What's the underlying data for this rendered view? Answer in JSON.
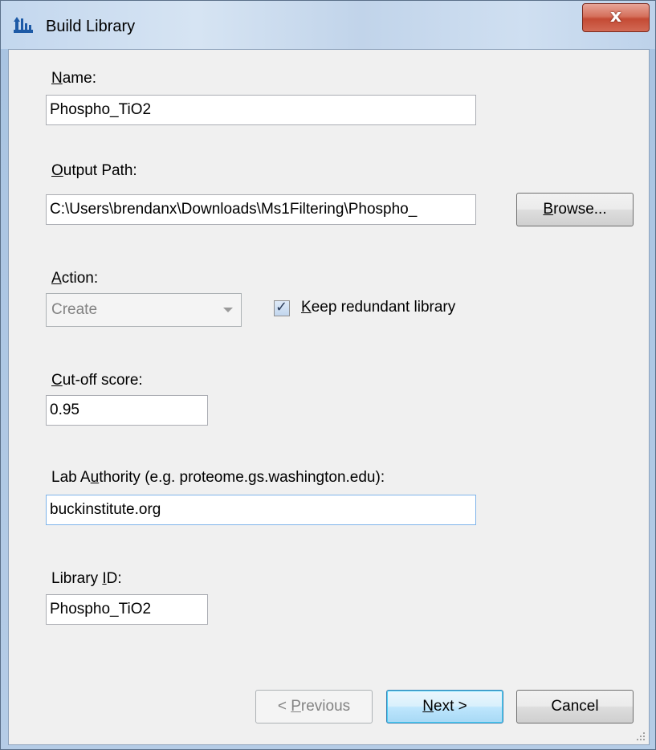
{
  "window": {
    "title": "Build Library",
    "close_glyph": "x"
  },
  "fields": {
    "name": {
      "label_u": "N",
      "label_rest": "ame:",
      "value": "Phospho_TiO2"
    },
    "output_path": {
      "label_u": "O",
      "label_rest": "utput Path:",
      "value": "C:\\Users\\brendanx\\Downloads\\Ms1Filtering\\Phospho_"
    },
    "action": {
      "label_u": "A",
      "label_rest": "ction:",
      "value": "Create"
    },
    "keep_redundant": {
      "label_u": "K",
      "label_rest": "eep redundant library",
      "checked": true
    },
    "cutoff": {
      "label_u": "C",
      "label_rest": "ut-off score:",
      "value": "0.95"
    },
    "lab_authority": {
      "label_pre": "Lab A",
      "label_u": "u",
      "label_rest": "thority (e.g. proteome.gs.washington.edu):",
      "value": "buckinstitute.org"
    },
    "library_id": {
      "label_pre": "Library ",
      "label_u": "I",
      "label_rest": "D:",
      "value": "Phospho_TiO2"
    }
  },
  "buttons": {
    "browse": {
      "u": "B",
      "rest": "rowse..."
    },
    "previous": {
      "pre": "< ",
      "u": "P",
      "rest": "revious"
    },
    "next": {
      "u": "N",
      "rest": "ext >"
    },
    "cancel": {
      "label": "Cancel"
    }
  },
  "icons": {
    "title": "library-icon",
    "check": "checkmark-icon"
  },
  "colors": {
    "close_red": "#c44a34",
    "focus_blue": "#7eb4ea",
    "dialog_bg": "#f0f0f0"
  }
}
